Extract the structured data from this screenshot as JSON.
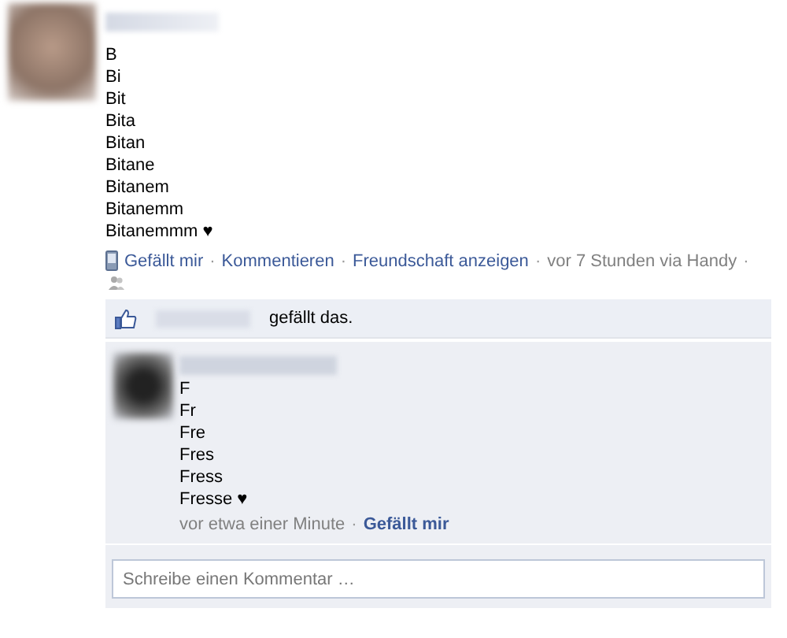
{
  "post": {
    "separator": "·",
    "lines": [
      "B",
      "Bi",
      "Bit",
      "Bita",
      "Bitan",
      "Bitane",
      "Bitanem",
      "Bitanemm",
      "Bitanemmm ♥"
    ],
    "actions": [
      {
        "label": "Gefällt mir",
        "kind": "link"
      },
      {
        "label": "Kommentieren",
        "kind": "link"
      },
      {
        "label": "Freundschaft anzeigen",
        "kind": "link"
      },
      {
        "label": "vor 7 Stunden via Handy",
        "kind": "meta"
      }
    ]
  },
  "likes": {
    "text": "gefällt das."
  },
  "comment": {
    "separator": "·",
    "lines": [
      "F",
      "Fr",
      "Fre",
      "Fres",
      "Fress",
      "Fresse ♥"
    ],
    "time": "vor etwa einer Minute",
    "like": "Gefällt mir"
  },
  "composer": {
    "placeholder": "Schreibe einen Kommentar …"
  }
}
